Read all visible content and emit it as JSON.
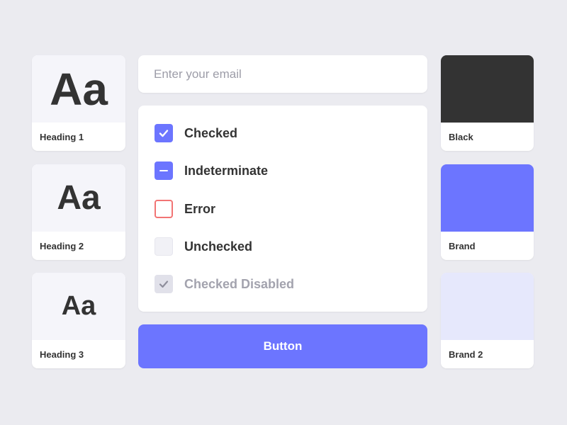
{
  "typography": [
    {
      "sample": "Aa",
      "label": "Heading 1"
    },
    {
      "sample": "Aa",
      "label": "Heading 2"
    },
    {
      "sample": "Aa",
      "label": "Heading 3"
    }
  ],
  "email": {
    "placeholder": "Enter your email",
    "value": ""
  },
  "checkboxes": [
    {
      "label": "Checked",
      "state": "checked"
    },
    {
      "label": "Indeterminate",
      "state": "indeterminate"
    },
    {
      "label": "Error",
      "state": "error"
    },
    {
      "label": "Unchecked",
      "state": "unchecked"
    },
    {
      "label": "Checked Disabled",
      "state": "checked-disabled"
    }
  ],
  "button": {
    "label": "Button"
  },
  "colors": [
    {
      "label": "Black",
      "hex": "#333333"
    },
    {
      "label": "Brand",
      "hex": "#6c75ff"
    },
    {
      "label": "Brand 2",
      "hex": "#e6e8fc"
    }
  ],
  "theme": {
    "brand": "#6c75ff",
    "error": "#f27474",
    "background": "#ebebf0"
  }
}
